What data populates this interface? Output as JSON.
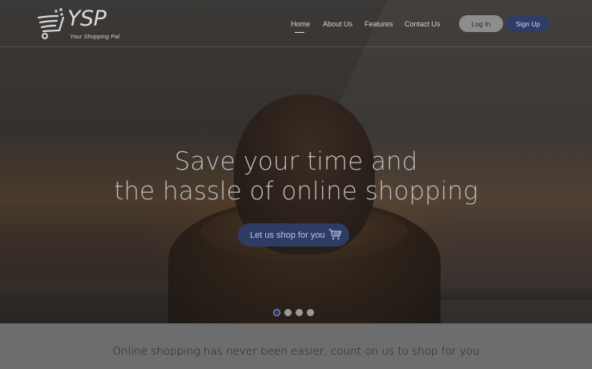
{
  "brand": {
    "logo_text": "YSP",
    "tagline": "Your Shopping Pal"
  },
  "nav": {
    "items": [
      {
        "label": "Home",
        "active": true
      },
      {
        "label": "About Us",
        "active": false
      },
      {
        "label": "Features",
        "active": false
      },
      {
        "label": "Contact Us",
        "active": false
      }
    ]
  },
  "auth": {
    "login_label": "Log In",
    "signup_label": "Sign Up"
  },
  "hero": {
    "headline_line1": "Save your time and",
    "headline_line2": "the hassle of online shopping",
    "cta_label": "Let us shop for you",
    "cta_icon": "shopping-cart-icon",
    "carousel": {
      "slide_count": 4,
      "active_index": 0
    }
  },
  "band": {
    "text": "Online shopping has never been easier, count on us to shop for you"
  },
  "colors": {
    "accent": "#2e3b63",
    "login_button": "#8d8d8d",
    "band_background": "#6d6d6d"
  }
}
